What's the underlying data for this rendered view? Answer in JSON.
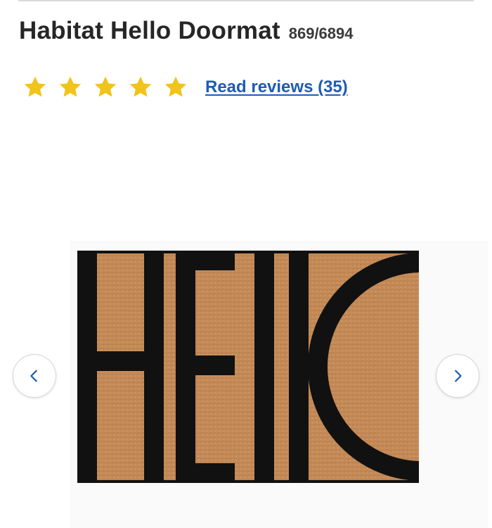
{
  "product": {
    "title": "Habitat Hello Doormat",
    "code": "869/6894"
  },
  "rating": {
    "stars": 5,
    "max_stars": 5,
    "star_color": "#f0c419",
    "reviews_link": "Read reviews (35)"
  },
  "gallery": {
    "image": "doormat-hello",
    "prev_icon": "chevron-left-icon",
    "next_icon": "chevron-right-icon"
  },
  "colors": {
    "link": "#1f5bb4",
    "mat": "#c48a57",
    "ink": "#111111"
  }
}
